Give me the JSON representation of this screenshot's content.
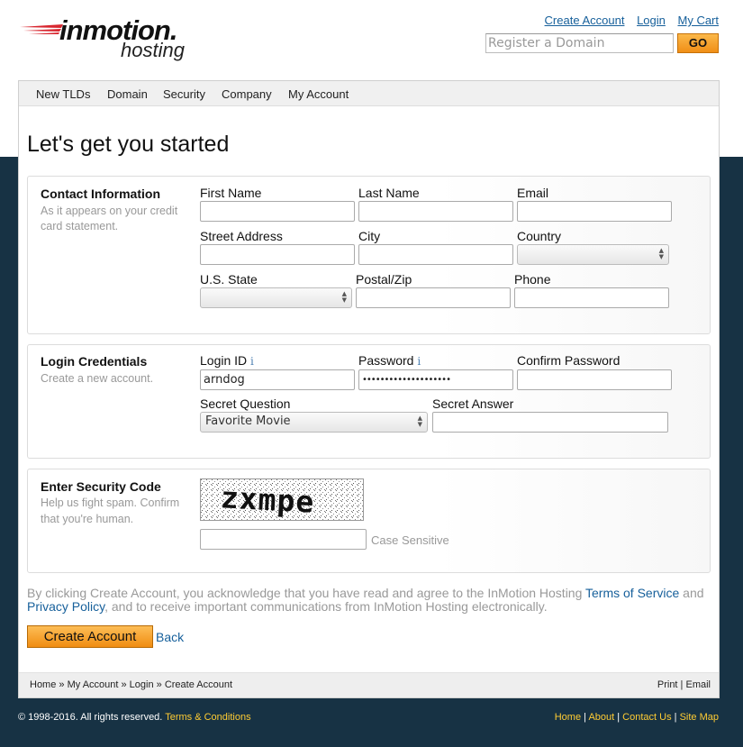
{
  "header": {
    "logo_main": "inmotion.",
    "logo_sub": "hosting",
    "links": [
      "Create Account",
      "Login",
      "My Cart"
    ],
    "domain_placeholder": "Register a Domain",
    "go_label": "GO"
  },
  "nav": [
    "New TLDs",
    "Domain",
    "Security",
    "Company",
    "My Account"
  ],
  "page_title": "Let's get you started",
  "contact": {
    "title": "Contact Information",
    "desc1": "As it appears on your credit",
    "desc2": "card statement.",
    "first_name": "First Name",
    "last_name": "Last Name",
    "email": "Email",
    "street": "Street Address",
    "city": "City",
    "country": "Country",
    "state": "U.S. State",
    "postal": "Postal/Zip",
    "phone": "Phone"
  },
  "login": {
    "title": "Login Credentials",
    "desc": "Create a new account.",
    "login_id_label": "Login ID",
    "login_id_value": "arndog",
    "password_label": "Password",
    "password_value": "••••••••••••••••••••",
    "confirm_label": "Confirm Password",
    "info_glyph": "i",
    "secret_q_label": "Secret Question",
    "secret_q_value": "Favorite Movie",
    "secret_a_label": "Secret Answer"
  },
  "security": {
    "title": "Enter Security Code",
    "desc1": "Help us fight spam. Confirm",
    "desc2": "that you're human.",
    "captcha_text": "zxmpe",
    "case_note": "Case Sensitive"
  },
  "legal": {
    "pre": "By clicking Create Account, you acknowledge that you have read and agree to the InMotion Hosting ",
    "tos": "Terms of Service",
    "and": " and ",
    "privacy": "Privacy Policy",
    "post": ", and to receive important communications from InMotion Hosting electronically."
  },
  "actions": {
    "create": "Create Account",
    "back": "Back"
  },
  "breadcrumb": {
    "home": "Home",
    "my_account": "My Account",
    "login": "Login",
    "create": "Create Account",
    "sep": " » "
  },
  "print_links": {
    "print": "Print",
    "email": "Email",
    "sep": " | "
  },
  "footer": {
    "copyright": "© 1998-2016. All rights reserved. ",
    "terms": "Terms & Conditions",
    "links": [
      "Home",
      "About",
      "Contact Us",
      "Site Map"
    ],
    "sep": " | "
  }
}
